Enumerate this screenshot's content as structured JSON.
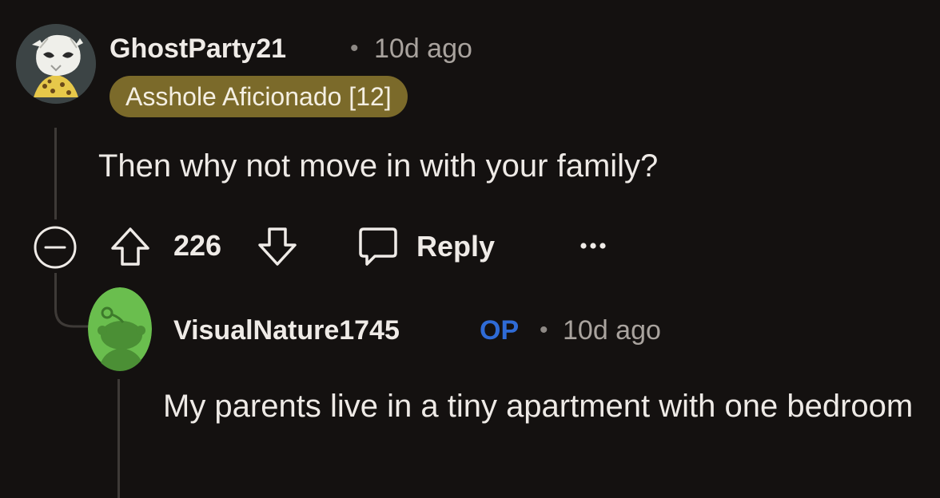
{
  "comments": [
    {
      "author": "GhostParty21",
      "time": "10d ago",
      "flair": "Asshole Aficionado [12]",
      "body": "Then why not move in with your family?",
      "score": "226",
      "reply_label": "Reply",
      "avatar_icon": "ghost-mask-avatar-icon"
    },
    {
      "author": "VisualNature1745",
      "op_badge": "OP",
      "time": "10d ago",
      "body": "My parents live in a tiny apartment with one bedroom",
      "avatar_icon": "snoo-avatar-icon"
    }
  ],
  "separator": "•",
  "colors": {
    "background": "#141110",
    "flair_bg": "#7b6a2a",
    "op_blue": "#2f6bd6",
    "avatar_green": "#6abe4e"
  }
}
